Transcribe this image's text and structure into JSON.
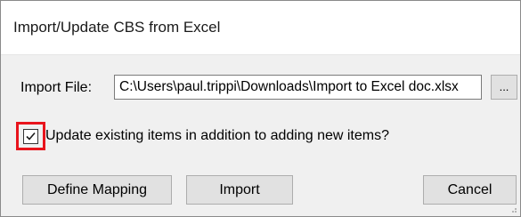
{
  "dialog": {
    "title": "Import/Update CBS from Excel"
  },
  "import_file": {
    "label": "Import File:",
    "value": "C:\\Users\\paul.trippi\\Downloads\\Import to Excel doc.xlsx",
    "browse_label": "..."
  },
  "update_option": {
    "checked": true,
    "label": "Update existing items in addition to adding new items?"
  },
  "buttons": {
    "define_mapping": "Define Mapping",
    "import": "Import",
    "cancel": "Cancel"
  },
  "icons": {
    "checkmark": "checkmark-icon",
    "resize_grip": "resize-grip-icon"
  },
  "colors": {
    "highlight": "#e8141c",
    "dialog_bg": "#f0f0f0",
    "button_bg": "#e1e1e1"
  }
}
